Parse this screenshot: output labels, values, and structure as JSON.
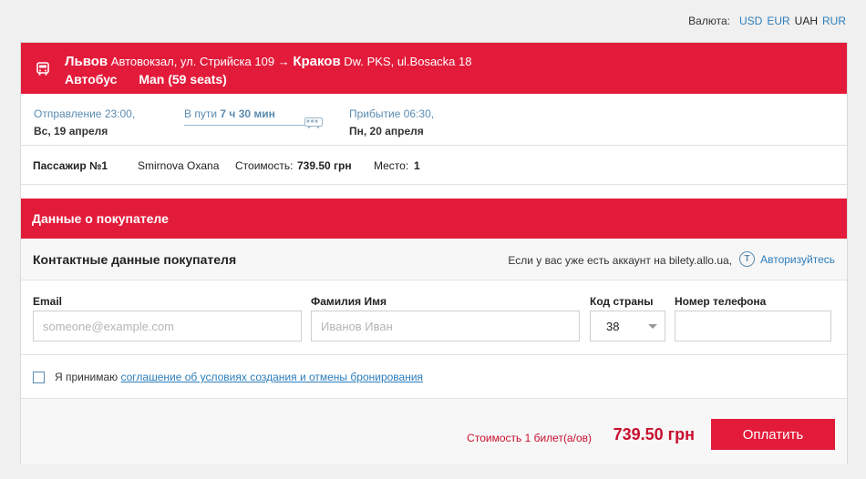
{
  "currency": {
    "label": "Валюта:",
    "options": [
      "USD",
      "EUR",
      "UAH",
      "RUR"
    ],
    "selected": "UAH"
  },
  "route": {
    "from_city": "Львов",
    "from_station": "Автовокзал, ул. Стрийска 109",
    "arrow": "→",
    "to_city": "Краков",
    "to_station": "Dw. PKS, ul.Bosacka 18",
    "transport": "Автобус",
    "bus_model": "Man (59 seats)"
  },
  "times": {
    "departure_label": "Отправление",
    "departure_time": "23:00,",
    "departure_date": "Вс, 19 апреля",
    "transit_label": "В пути",
    "transit_duration": "7 ч 30 мин",
    "arrival_label": "Прибытие",
    "arrival_time": "06:30,",
    "arrival_date": "Пн, 20 апреля"
  },
  "passenger": {
    "label": "Пассажир №1",
    "name": "Smirnova Oxana",
    "cost_label": "Стоимость:",
    "cost_value": "739.50 грн",
    "seat_label": "Место:",
    "seat_value": "1"
  },
  "buyer": {
    "section_title": "Данные о покупателе",
    "contact_title": "Контактные данные покупателя",
    "account_text": "Если у вас уже есть аккаунт на bilety.allo.ua,",
    "login_icon_glyph": "T",
    "login_link": "Авторизуйтесь"
  },
  "form": {
    "email_label": "Email",
    "email_placeholder": "someone@example.com",
    "name_label": "Фамилия Имя",
    "name_placeholder": "Иванов Иван",
    "country_label": "Код страны",
    "country_value": "38",
    "phone_label": "Номер телефона",
    "phone_value": ""
  },
  "agreement": {
    "prefix": "Я принимаю",
    "link": "соглашение об условиях создания и отмены бронирования",
    "checked": false
  },
  "payment": {
    "label": "Стоимость 1 билет(а/ов)",
    "total": "739.50 грн",
    "button": "Оплатить"
  },
  "colors": {
    "accent": "#e31b3a",
    "link": "#2c7dbb",
    "price": "#c8102e"
  }
}
